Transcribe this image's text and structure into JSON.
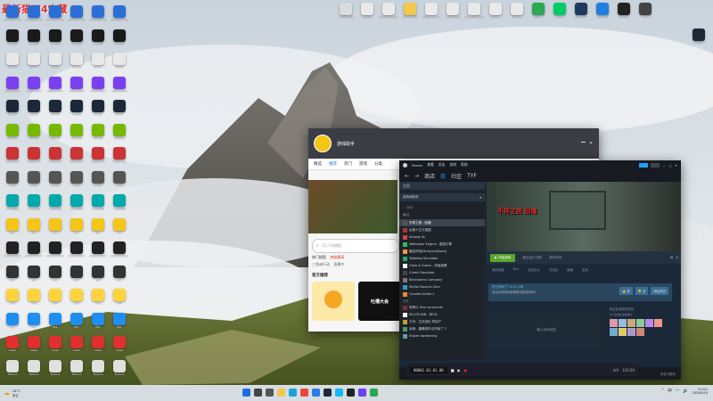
{
  "desktop": {
    "watermark_logo_text": "最新猫刀4宝藏",
    "icons_left": [
      {
        "label": "Windows App",
        "color": "#2a6fd6"
      },
      {
        "label": "VRiHigo",
        "color": "#1a1a1a"
      },
      {
        "label": "Ubisoft",
        "color": "#e8e8e8"
      },
      {
        "label": "MotionCmd",
        "color": "#7b3ff2"
      },
      {
        "label": "Steam",
        "color": "#1b2838"
      },
      {
        "label": "Geforce",
        "color": "#76b900"
      },
      {
        "label": "Wallpaper",
        "color": "#c33"
      },
      {
        "label": "Cross",
        "color": "#555"
      },
      {
        "label": "UU加速器",
        "color": "#0aa"
      },
      {
        "label": "QQ",
        "color": "#f5c518"
      },
      {
        "label": "GameViewer",
        "color": "#222"
      },
      {
        "label": "Epic",
        "color": "#333"
      },
      {
        "label": "OBS",
        "color": "#ffd43b"
      },
      {
        "label": "PCL",
        "color": "#1f8ef1"
      },
      {
        "label": "Clash",
        "color": "#e02f2f"
      },
      {
        "label": "Toolbox",
        "color": "#e0e0e0"
      }
    ],
    "icons_top": [
      {
        "label": "ConvertLab",
        "color": "#dcdcdc"
      },
      {
        "label": "Installer",
        "color": "#e9e9e9"
      },
      {
        "label": "WindowsAppsRun",
        "color": "#e9e9e9"
      },
      {
        "label": "SteamWorks",
        "color": "#f2c94c"
      },
      {
        "label": "Loopback Inst",
        "color": "#e9e9e9"
      },
      {
        "label": "Loopback2",
        "color": "#e9e9e9"
      },
      {
        "label": "DK Downloader",
        "color": "#e9e9e9"
      },
      {
        "label": "Update",
        "color": "#e9e9e9"
      },
      {
        "label": "Config",
        "color": "#e9e9e9"
      },
      {
        "label": "PeaCT",
        "color": "#2aa852"
      },
      {
        "label": "Arch",
        "color": "#0c6"
      },
      {
        "label": "Steam++",
        "color": "#1e3a5f"
      },
      {
        "label": "Overlay",
        "color": "#1f7fe0"
      },
      {
        "label": "Terminal",
        "color": "#222"
      },
      {
        "label": "T8",
        "color": "#444"
      },
      {
        "label": "Steam",
        "color": "#1b2838"
      }
    ]
  },
  "gamebar": {
    "app_name": "游戏助手",
    "tabs": [
      "精选",
      "推荐",
      "热门",
      "游戏",
      "分类"
    ],
    "search_placeholder": "【1人1地版】",
    "hot_label": "热门搜索",
    "hot_items": [
      "热度最高",
      "三角洲行动",
      "直播中"
    ],
    "section_label": "官方推荐",
    "card_title": "吐槽大会"
  },
  "steam": {
    "menu": [
      "Steam",
      "查看",
      "好友",
      "游戏",
      "帮助"
    ],
    "nav": [
      "商店",
      "库",
      "社区",
      "TYF"
    ],
    "nav_active": 1,
    "home_label": "主页",
    "filter_label": "游戏和软件",
    "search_placeholder": "搜索",
    "recent_label": "最近",
    "games": [
      "不祥之夜：回魂",
      "乱离人生与祖国",
      "Among Us",
      "Wallpaper Engine：壁纸引擎",
      "最佳时刻(MuhyungGood)",
      "Tabletop Simulator",
      "Draw & Guess - 你画我猜",
      "Crime Simulator",
      "Backrooms Company",
      "Stellar Bounce Zero",
      "Counter-Strike 2",
      "恐怖片 Fear surrounds",
      "KILLER INN - BETA",
      "方舟：生存进化 同用户",
      "深渊：晨曦城市合作版了 2",
      "Sniper Awakening"
    ],
    "section_mid_label": "七天",
    "game_title": "不祥之夜 回魂",
    "play_label": "开始游戏",
    "last_played_label": "最后运行日期",
    "playtime_label": "游戏时间",
    "tabs": [
      "商店页面",
      "DLC",
      "社区中心",
      "讨论区",
      "指南",
      "支持"
    ],
    "review_prompt": "您已游玩了 10.5 小时",
    "review_prompt_sub": "您会向其他玩家推荐这款游戏吗？",
    "recommend_label": "是",
    "not_recommend_label": "否",
    "later_label": "稍后再说",
    "activity_placeholder": "输入游戏动态",
    "friends_label": "玩过此游戏的好友",
    "friends_count": "10 位您关注的用户",
    "status_text": "下载 - 1 个项目中的 2 项已完成",
    "friends_chat_label": "好友与聊天"
  },
  "media_player": {
    "timecode": "00001.01.01.00",
    "bpm": "120.00",
    "signature": "4/4"
  },
  "taskbar": {
    "weather_temp": "24°C",
    "weather_text": "多云",
    "apps": [
      {
        "name": "start",
        "color": "#1f6fe0"
      },
      {
        "name": "search",
        "color": "#444"
      },
      {
        "name": "taskview",
        "color": "#555"
      },
      {
        "name": "explorer",
        "color": "#f2c94c"
      },
      {
        "name": "edge",
        "color": "#1aa3d8"
      },
      {
        "name": "chrome",
        "color": "#e8453c"
      },
      {
        "name": "store",
        "color": "#2b7de9"
      },
      {
        "name": "steam",
        "color": "#1b2838"
      },
      {
        "name": "qq",
        "color": "#12b7f5"
      },
      {
        "name": "terminal",
        "color": "#222"
      },
      {
        "name": "media",
        "color": "#6b3ff2"
      },
      {
        "name": "wechat",
        "color": "#2aa852"
      }
    ],
    "ime_label": "中",
    "time": "21:02",
    "date": "2025/8/19"
  }
}
